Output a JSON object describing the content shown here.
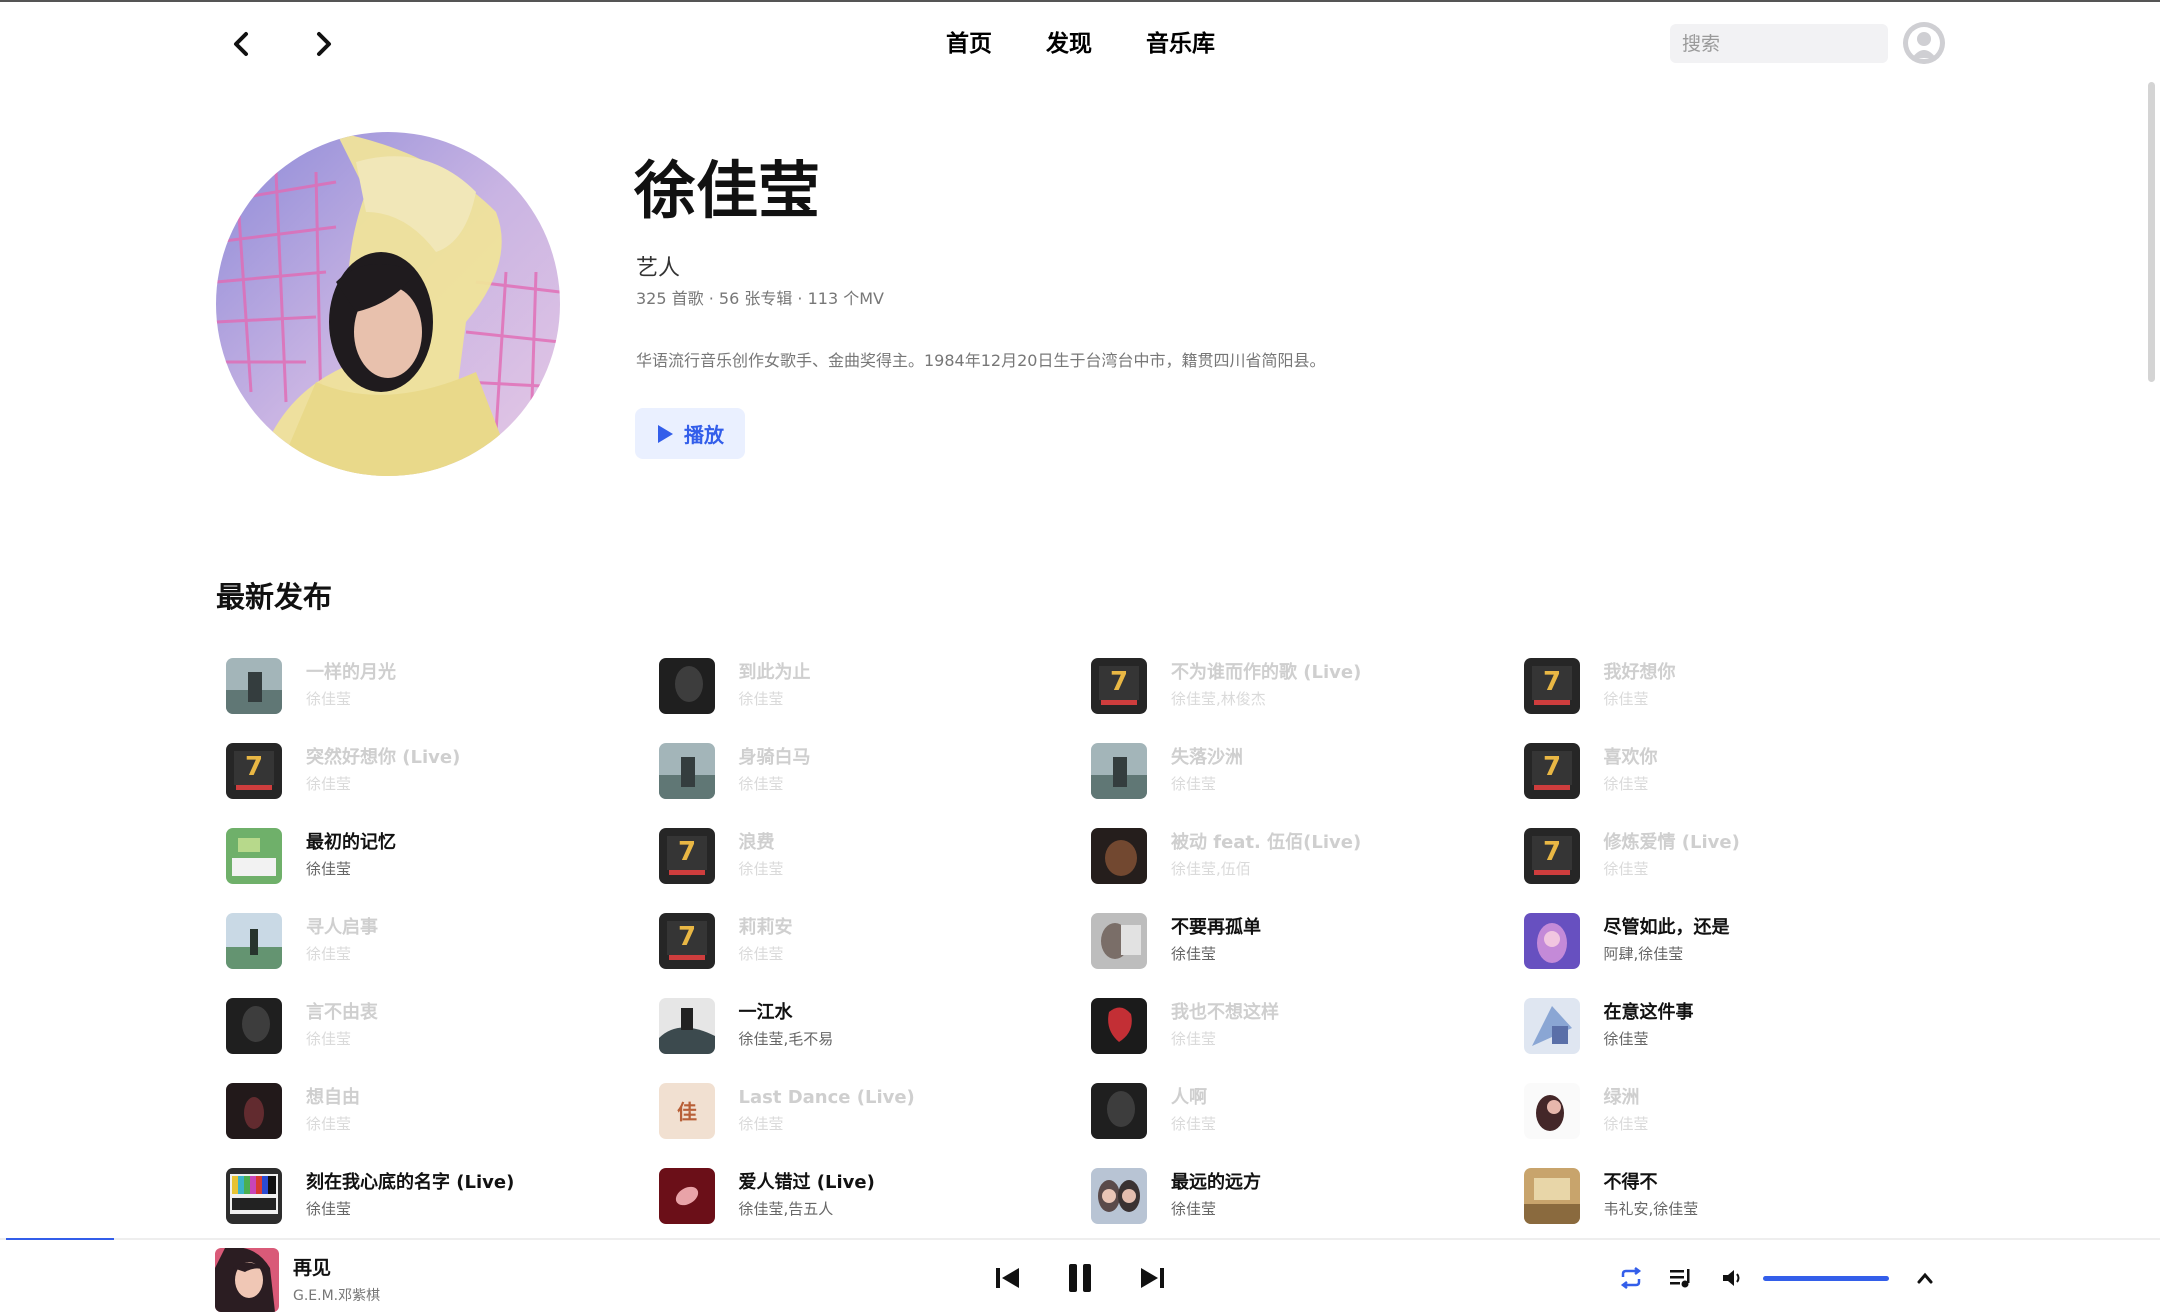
{
  "nav": {
    "back_icon": "chevron-left-icon",
    "forward_icon": "chevron-right-icon",
    "menu": [
      "首页",
      "发现",
      "音乐库"
    ],
    "search_placeholder": "搜索"
  },
  "artist": {
    "name": "徐佳莹",
    "role": "艺人",
    "stats": "325 首歌 · 56 张专辑 · 113 个MV",
    "bio": "华语流行音乐创作女歌手、金曲奖得主。1984年12月20日生于台湾台中市，籍贯四川省简阳县。",
    "play_label": "播放"
  },
  "latest": {
    "title": "最新发布",
    "tracks": [
      {
        "title": "一样的月光",
        "artist": "徐佳莹",
        "available": false,
        "cover": "a"
      },
      {
        "title": "到此为止",
        "artist": "徐佳莹",
        "available": false,
        "cover": "dark"
      },
      {
        "title": "不为谁而作的歌 (Live)",
        "artist": "徐佳莹,林俊杰",
        "available": false,
        "cover": "singer"
      },
      {
        "title": "我好想你",
        "artist": "徐佳莹",
        "available": false,
        "cover": "singer"
      },
      {
        "title": "突然好想你 (Live)",
        "artist": "徐佳莹",
        "available": false,
        "cover": "singer"
      },
      {
        "title": "身骑白马",
        "artist": "徐佳莹",
        "available": false,
        "cover": "a"
      },
      {
        "title": "失落沙洲",
        "artist": "徐佳莹",
        "available": false,
        "cover": "a"
      },
      {
        "title": "喜欢你",
        "artist": "徐佳莹",
        "available": false,
        "cover": "singer"
      },
      {
        "title": "最初的记忆",
        "artist": "徐佳莹",
        "available": true,
        "cover": "green"
      },
      {
        "title": "浪费",
        "artist": "徐佳莹",
        "available": false,
        "cover": "singer"
      },
      {
        "title": "被动 feat. 伍佰(Live)",
        "artist": "徐佳莹,伍佰",
        "available": false,
        "cover": "brown"
      },
      {
        "title": "修炼爱情 (Live)",
        "artist": "徐佳莹",
        "available": false,
        "cover": "singer"
      },
      {
        "title": "寻人启事",
        "artist": "徐佳莹",
        "available": false,
        "cover": "field"
      },
      {
        "title": "莉莉安",
        "artist": "徐佳莹",
        "available": false,
        "cover": "singer"
      },
      {
        "title": "不要再孤单",
        "artist": "徐佳莹",
        "available": true,
        "cover": "grey"
      },
      {
        "title": "尽管如此，还是",
        "artist": "阿肆,徐佳莹",
        "available": true,
        "cover": "purple"
      },
      {
        "title": "言不由衷",
        "artist": "徐佳莹",
        "available": false,
        "cover": "dark"
      },
      {
        "title": "一江水",
        "artist": "徐佳莹,毛不易",
        "available": true,
        "cover": "ink"
      },
      {
        "title": "我也不想这样",
        "artist": "徐佳莹",
        "available": false,
        "cover": "red"
      },
      {
        "title": "在意这件事",
        "artist": "徐佳莹",
        "available": true,
        "cover": "paint"
      },
      {
        "title": "想自由",
        "artist": "徐佳莹",
        "available": false,
        "cover": "darkred"
      },
      {
        "title": "Last Dance (Live)",
        "artist": "徐佳莹",
        "available": false,
        "cover": "peach"
      },
      {
        "title": "人啊",
        "artist": "徐佳莹",
        "available": false,
        "cover": "dark"
      },
      {
        "title": "绿洲",
        "artist": "徐佳莹",
        "available": false,
        "cover": "pinkw"
      },
      {
        "title": "刻在我心底的名字 (Live)",
        "artist": "徐佳莹",
        "available": true,
        "cover": "tv"
      },
      {
        "title": "爱人错过 (Live)",
        "artist": "徐佳莹,告五人",
        "available": true,
        "cover": "maroon"
      },
      {
        "title": "最远的远方",
        "artist": "徐佳莹",
        "available": true,
        "cover": "duo"
      },
      {
        "title": "不得不",
        "artist": "韦礼安,徐佳莹",
        "available": true,
        "cover": "tan"
      }
    ]
  },
  "player": {
    "title": "再见",
    "artist": "G.E.M.邓紫棋",
    "prev_icon": "skip-previous-icon",
    "pause_icon": "pause-icon",
    "next_icon": "skip-next-icon",
    "repeat_icon": "repeat-icon",
    "queue_icon": "playlist-icon",
    "volume_icon": "volume-icon",
    "expand_icon": "chevron-up-icon",
    "progress": 0.05,
    "volume": 1.0
  },
  "colors": {
    "accent": "#335eea",
    "unavailable_text": "#cfcfcf"
  }
}
